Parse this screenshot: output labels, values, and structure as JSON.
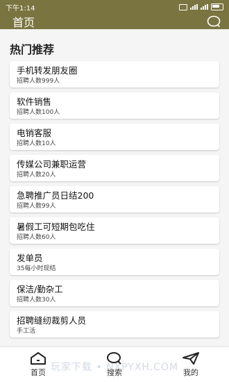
{
  "status": {
    "time": "下午1:14"
  },
  "header": {
    "title": "首页"
  },
  "section_title": "热门推荐",
  "jobs": [
    {
      "title": "手机转发朋友圈",
      "sub": "招聘人数999人"
    },
    {
      "title": "软件销售",
      "sub": "招聘人数100人"
    },
    {
      "title": "电销客服",
      "sub": "招聘人数10人"
    },
    {
      "title": "传媒公司兼职运营",
      "sub": "招聘人数20人"
    },
    {
      "title": "急聘推广员日结200",
      "sub": "招聘人数99人"
    },
    {
      "title": "暑假工可短期包吃住",
      "sub": "招聘人数60人"
    },
    {
      "title": "发单员",
      "sub": "35每小时现结"
    },
    {
      "title": "保洁/勤杂工",
      "sub": "招聘人数30人"
    },
    {
      "title": "招聘缝纫裁剪人员",
      "sub": "手工活"
    }
  ],
  "tabs": [
    {
      "label": "首页",
      "icon": "home-icon"
    },
    {
      "label": "搜索",
      "icon": "search-icon"
    },
    {
      "label": "我的",
      "icon": "send-icon"
    }
  ],
  "watermark": "玩家下载 • NXPYXH.COM",
  "colors": {
    "brand": "#7a7440",
    "background": "#f5f5f5"
  }
}
